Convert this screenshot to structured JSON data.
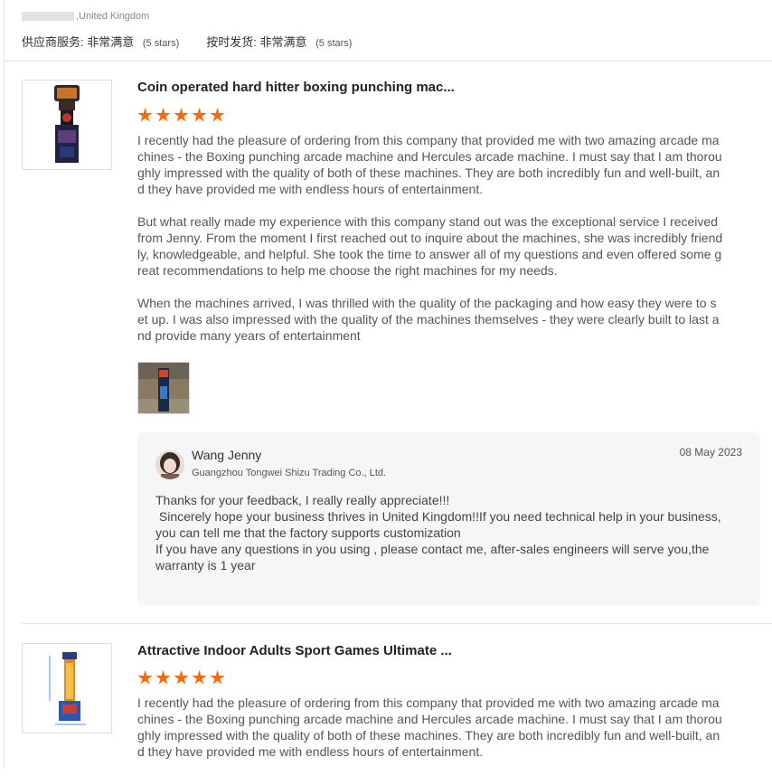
{
  "header": {
    "reviewer_location": ",United Kingdom",
    "ratings": [
      {
        "label": "供应商服务:",
        "value": "非常满意",
        "stars": "(5 stars)"
      },
      {
        "label": "按时发货:",
        "value": "非常满意",
        "stars": "(5 stars)"
      }
    ]
  },
  "colors": {
    "star": "#ff6a00",
    "reply_bg": "#f5f6f7"
  },
  "reviews": [
    {
      "title": "Coin operated hard hitter boxing punching mac...",
      "rating": 5,
      "paragraphs": [
        "I recently had the pleasure of ordering from this company that provided me with two amazing arcade machines - the Boxing punching arcade machine and Hercules arcade machine. I must say that I am thoroughly impressed with the quality of both of these machines. They are both incredibly fun and well-built, and they have provided me with endless hours of entertainment.",
        "But what really made my experience with this company stand out was the exceptional service I received from Jenny. From the moment I first reached out to inquire about the machines, she was incredibly friendly, knowledgeable, and helpful. She took the time to answer all of my questions and even offered some great recommendations to help me choose the right machines for my needs.",
        "When the machines arrived, I was thrilled with the quality of the packaging and how easy they were to set up. I was also impressed with the quality of the machines themselves - they were clearly built to last and provide many years of entertainment"
      ],
      "reply": {
        "name": "Wang Jenny",
        "company": "Guangzhou Tongwei Shizu Trading Co., Ltd.",
        "date": "08 May 2023",
        "lines": [
          "Thanks for your feedback, I really really appreciate!!!",
          " Sincerely hope your business thrives in United Kingdom!!If you need technical help in your business, you can tell me that the factory supports customization",
          "If you have any questions in you using , please contact me, after-sales engineers will serve you,the warranty is 1 year"
        ]
      }
    },
    {
      "title": "Attractive Indoor Adults Sport Games Ultimate ...",
      "rating": 5,
      "paragraphs": [
        "I recently had the pleasure of ordering from this company that provided me with two amazing arcade machines - the Boxing punching arcade machine and Hercules arcade machine. I must say that I am thoroughly impressed with the quality of both of these machines. They are both incredibly fun and well-built, and they have provided me with endless hours of entertainment."
      ]
    }
  ]
}
